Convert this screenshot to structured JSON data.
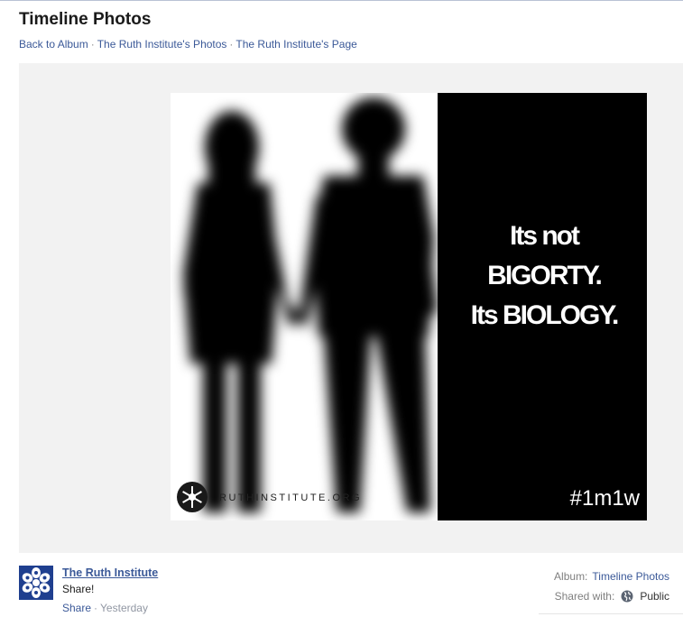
{
  "header": {
    "title": "Timeline Photos",
    "breadcrumbs": [
      {
        "label": "Back to Album"
      },
      {
        "label": "The Ruth Institute's Photos"
      },
      {
        "label": "The Ruth Institute's Page"
      }
    ],
    "separator": "·"
  },
  "photo": {
    "headline_line1": "Its not",
    "headline_line2": "BIGORTY.",
    "headline_line3": "Its BIOLOGY.",
    "hashtag": "#1m1w",
    "watermark": "RUTHINSTITUTE.ORG",
    "left_bg": "#ffffff",
    "right_bg": "#000000"
  },
  "post": {
    "page_name": "The Ruth Institute",
    "caption": "Share!",
    "share_label": "Share",
    "time": "Yesterday",
    "separator": "·"
  },
  "meta": {
    "album_label": "Album:",
    "album_value": "Timeline Photos",
    "shared_label": "Shared with:",
    "shared_value": "Public",
    "privacy_icon": "globe-icon"
  },
  "colors": {
    "link": "#3b5998",
    "stage_bg": "#f2f2f2",
    "avatar_blue": "#1f3f8f"
  }
}
